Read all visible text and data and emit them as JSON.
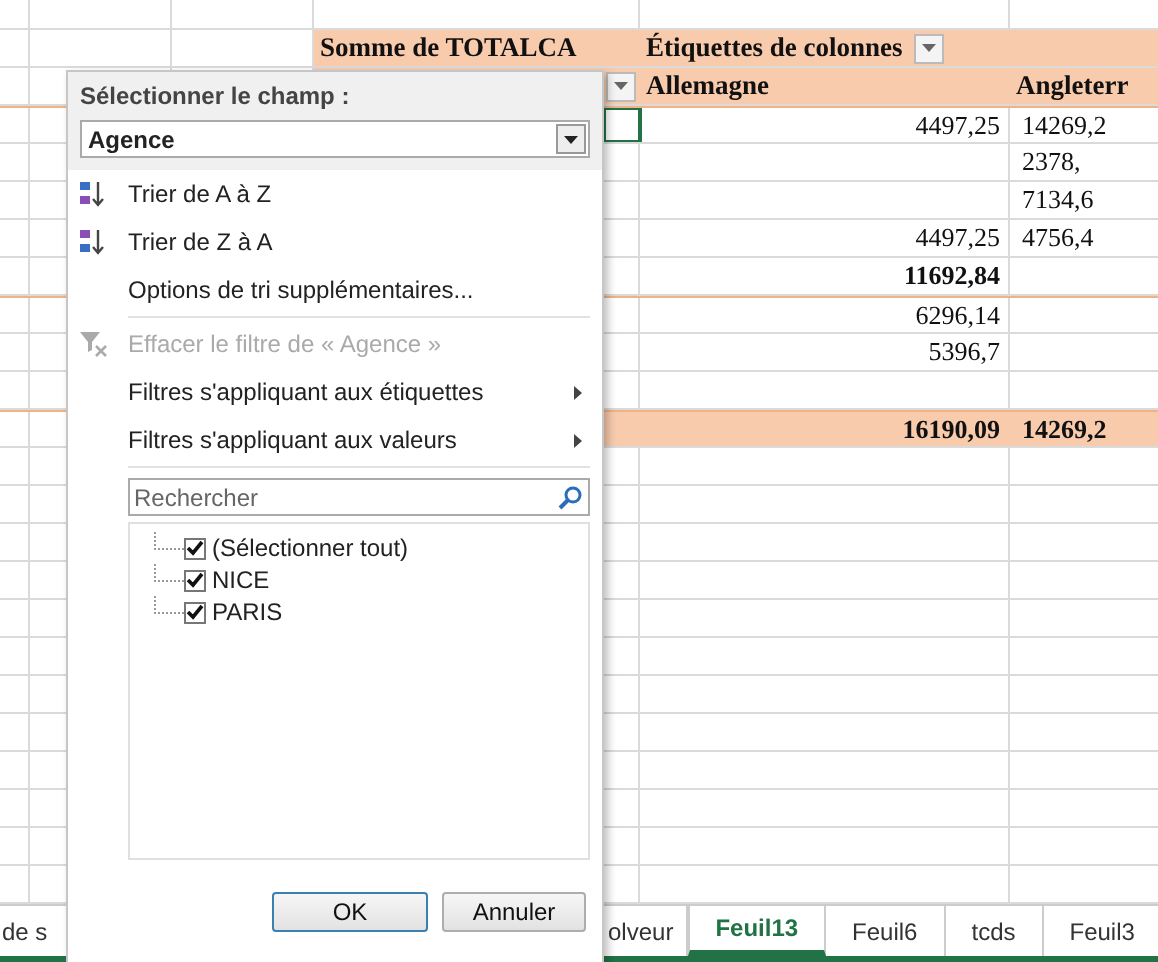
{
  "pivot": {
    "value_label": "Somme de TOTALCA",
    "column_label": "Étiquettes de colonnes",
    "columns": [
      "Allemagne",
      "Angleterr"
    ],
    "rows": [
      {
        "kind": "group",
        "allemagne": "4497,25",
        "angleterre": "14269,2"
      },
      {
        "kind": "item",
        "angleterre": "2378,"
      },
      {
        "kind": "item",
        "angleterre": "7134,6"
      },
      {
        "kind": "item",
        "allemagne": "4497,25",
        "angleterre": "4756,4"
      },
      {
        "kind": "subtotal",
        "allemagne": "11692,84"
      },
      {
        "kind": "group_item",
        "allemagne": "6296,14"
      },
      {
        "kind": "item",
        "allemagne": "5396,7"
      },
      {
        "kind": "item"
      },
      {
        "kind": "total",
        "allemagne": "16190,09",
        "angleterre": "14269,2"
      }
    ]
  },
  "filter_menu": {
    "field_label": "Sélectionner le champ :",
    "field_value": "Agence",
    "items": [
      {
        "kind": "sort_asc",
        "label": "Trier de A à Z",
        "disabled": false
      },
      {
        "kind": "sort_desc",
        "label": "Trier de Z à A",
        "disabled": false
      },
      {
        "kind": "plain",
        "label": "Options de tri supplémentaires...",
        "disabled": false
      },
      {
        "kind": "clear_filter",
        "label": "Effacer le filtre de « Agence »",
        "disabled": true
      },
      {
        "kind": "submenu",
        "label": "Filtres s'appliquant aux étiquettes",
        "disabled": false
      },
      {
        "kind": "submenu",
        "label": "Filtres s'appliquant aux valeurs",
        "disabled": false
      }
    ],
    "search": {
      "placeholder": "Rechercher"
    },
    "values": [
      {
        "label": "(Sélectionner tout)",
        "checked": true
      },
      {
        "label": "NICE",
        "checked": true
      },
      {
        "label": "PARIS",
        "checked": true
      }
    ],
    "buttons": [
      {
        "label": "OK",
        "default": true
      },
      {
        "label": "Annuler",
        "default": false
      }
    ]
  },
  "sheet_tabs": [
    {
      "label": "de s",
      "selected": false
    },
    {
      "label": "olveur",
      "selected": false
    },
    {
      "label": "Feuil13",
      "selected": true
    },
    {
      "label": "Feuil6",
      "selected": false
    },
    {
      "label": "tcds",
      "selected": false
    },
    {
      "label": "Feuil3",
      "selected": false
    }
  ]
}
